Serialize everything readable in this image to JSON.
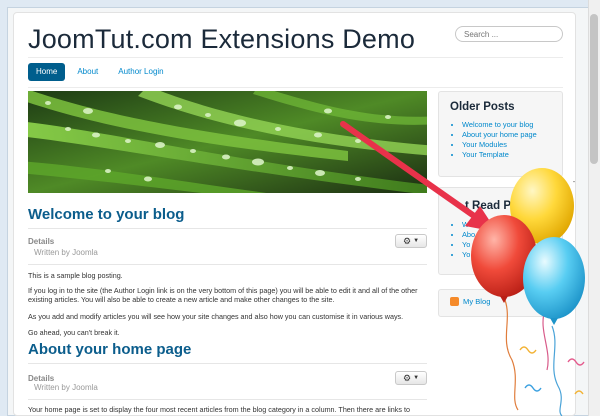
{
  "site": {
    "title": "JoomTut.com Extensions Demo",
    "search_placeholder": "Search ..."
  },
  "nav": [
    "Home",
    "About",
    "Author Login"
  ],
  "posts": [
    {
      "title": "Welcome to your blog",
      "details_label": "Details",
      "written_by": "Written by Joomla",
      "paragraphs": [
        "This is a sample blog posting.",
        "If you log in to the site (the Author Login link is on the very bottom of this page) you will be able to edit it and all of the other existing articles. You will also be able to create a new article and make other changes to the site.",
        "As you add and modify articles you will see how your site changes and also how you can customise it in various ways.",
        "Go ahead, you can't break it."
      ]
    },
    {
      "title": "About your home page",
      "details_label": "Details",
      "written_by": "Written by Joomla",
      "paragraphs": [
        "Your home page is set to display the four most recent articles from the blog category in a column. Then there are links to"
      ]
    }
  ],
  "sidebar": {
    "older_posts": {
      "title": "Older Posts",
      "items": [
        "Welcome to your blog",
        "About your home page",
        "Your Modules",
        "Your Template"
      ]
    },
    "most_read": {
      "title_visible": "t Read P",
      "items_visible": [
        "W",
        "Abo",
        "Yo",
        "Yo"
      ]
    },
    "feed": {
      "label": "My Blog"
    }
  },
  "overlay": {
    "close_glyph": "×",
    "minimize_glyph": "–"
  },
  "colors": {
    "accent": "#005e8d",
    "link": "#0088cc",
    "heading": "#0b5d8c",
    "arrow": "#e8324a"
  }
}
